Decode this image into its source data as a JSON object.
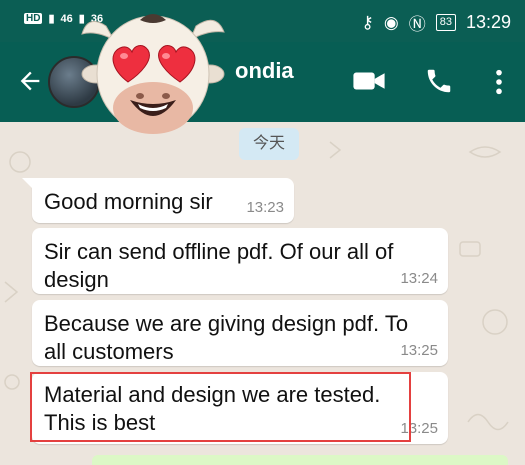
{
  "status_bar": {
    "network_badge": "HD",
    "signal_1": "46",
    "signal_2": "36",
    "battery": "83",
    "time": "13:29"
  },
  "app_bar": {
    "contact_name_visible": "ondia"
  },
  "chat": {
    "date_chip": "今天",
    "messages": [
      {
        "text": "Good morning sir",
        "time": "13:23"
      },
      {
        "text_line1": "Sir can send offline pdf. Of our all of",
        "text_line2": "design",
        "time": "13:24"
      },
      {
        "text_line1": "Because we are giving design pdf. To",
        "text_line2": "all customers",
        "time": "13:25"
      },
      {
        "text_line1": "Material and design we are tested.",
        "text_line2": "This is best",
        "time": "13:25"
      }
    ]
  },
  "colors": {
    "header": "#075e54",
    "chat_bg": "#ece5dd",
    "highlight": "#e4403f",
    "outgoing_bubble": "#dcf8c6"
  }
}
